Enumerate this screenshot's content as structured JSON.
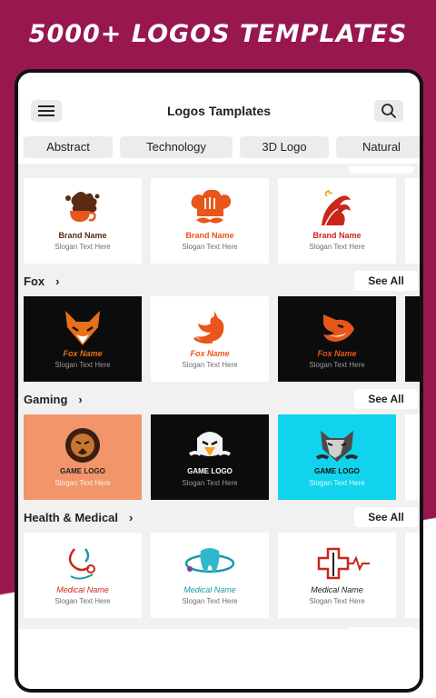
{
  "headline": "5000+ LOGOS TEMPLATES",
  "colors": {
    "background": "#98174f",
    "brand_orange": "#e8561a",
    "fox_orange": "#e8561a"
  },
  "app": {
    "title": "Logos Tamplates",
    "menu_icon": "hamburger-menu-icon",
    "search_icon": "search-icon"
  },
  "categories": [
    "Abstract",
    "Technology",
    "3D Logo",
    "Natural"
  ],
  "sections": [
    {
      "title": "",
      "cards": [
        {
          "name": "Brand Name",
          "slogan": "Slogan Text Here",
          "icon": "coffee-splash-logo"
        },
        {
          "name": "Brand Name",
          "slogan": "Slogan Text Here",
          "icon": "chef-hat-logo"
        },
        {
          "name": "Brand Name",
          "slogan": "Slogan Text Here",
          "icon": "wave-logo"
        }
      ]
    },
    {
      "title": "Fox",
      "see_all": "See All",
      "cards": [
        {
          "name": "Fox Name",
          "slogan": "Slogan Text Here",
          "icon": "fox-head-logo"
        },
        {
          "name": "Fox Name",
          "slogan": "Slogan Text Here",
          "icon": "fox-body-logo"
        },
        {
          "name": "Fox Name",
          "slogan": "Slogan Text Here",
          "icon": "fox-side-logo"
        }
      ]
    },
    {
      "title": "Gaming",
      "see_all": "See All",
      "cards": [
        {
          "name": "GAME LOGO",
          "slogan": "Slogan Text Here",
          "icon": "lion-mascot-logo"
        },
        {
          "name": "GAME LOGO",
          "slogan": "Slogan Text Here",
          "icon": "eagle-mascot-logo"
        },
        {
          "name": "GAME LOGO",
          "slogan": "Slogan Text Here",
          "icon": "wolf-mascot-logo"
        }
      ]
    },
    {
      "title": "Health & Medical",
      "see_all": "See All",
      "cards": [
        {
          "name": "Medical Name",
          "slogan": "Slogan Text Here",
          "icon": "stethoscope-logo"
        },
        {
          "name": "Medical Name",
          "slogan": "Slogan Text Here",
          "icon": "tooth-atom-logo"
        },
        {
          "name": "Medical Name",
          "slogan": "Slogan Text Here",
          "icon": "medical-cross-logo"
        }
      ]
    }
  ]
}
